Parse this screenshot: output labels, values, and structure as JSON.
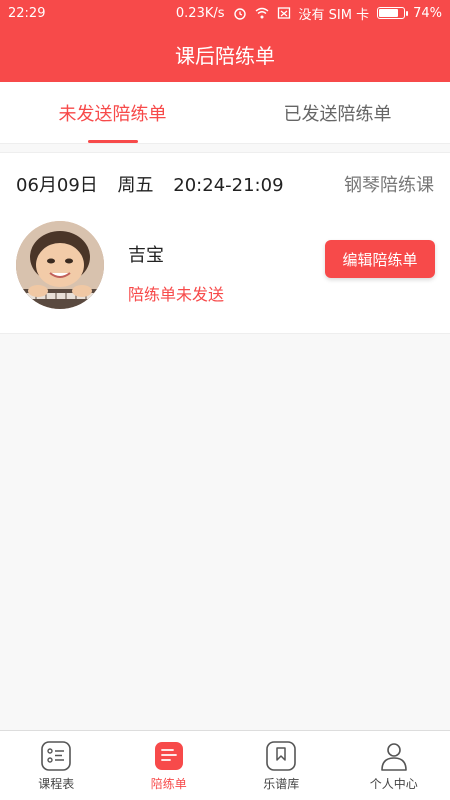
{
  "status": {
    "time": "22:29",
    "speed": "0.23K/s",
    "carrier": "没有 SIM 卡",
    "battery": "74%",
    "battery_level": 0.74
  },
  "header": {
    "title": "课后陪练单"
  },
  "tabs": [
    {
      "label": "未发送陪练单",
      "active": true
    },
    {
      "label": "已发送陪练单",
      "active": false
    }
  ],
  "card": {
    "date": "06月09日",
    "weekday": "周五",
    "time_range": "20:24-21:09",
    "course": "钢琴陪练课",
    "student_name": "吉宝",
    "status": "陪练单未发送",
    "edit_label": "编辑陪练单"
  },
  "bottom_nav": [
    {
      "label": "课程表",
      "icon": "schedule-icon"
    },
    {
      "label": "陪练单",
      "icon": "practice-list-icon",
      "active": true
    },
    {
      "label": "乐谱库",
      "icon": "score-library-icon"
    },
    {
      "label": "个人中心",
      "icon": "profile-icon"
    }
  ],
  "colors": {
    "accent": "#f74a4a"
  }
}
